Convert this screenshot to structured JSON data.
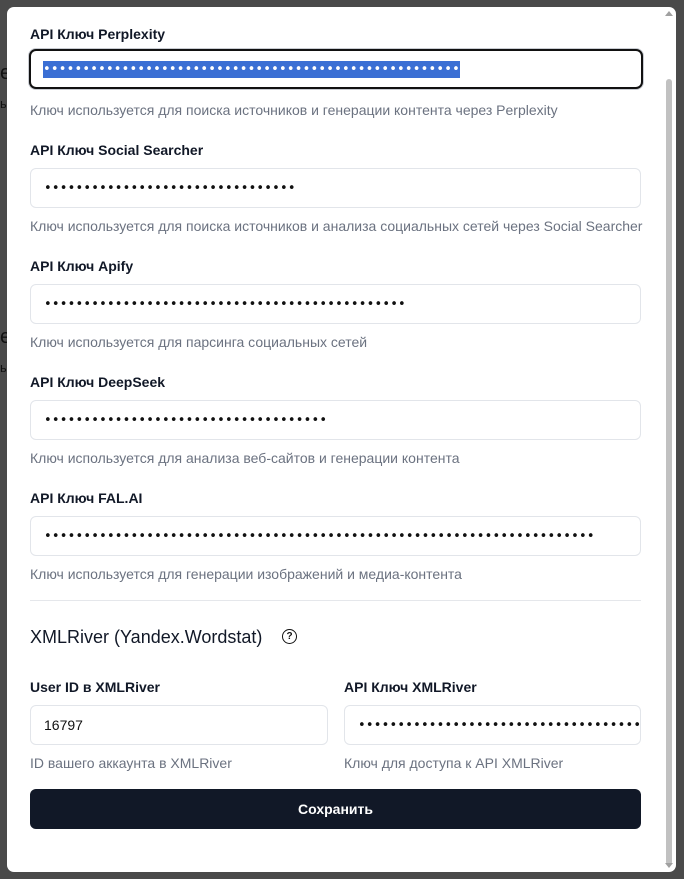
{
  "fields": [
    {
      "label": "API Ключ Perplexity",
      "value": "•••••••••••••••••••••••••••••••••••••••••••••••••••••",
      "hint": "Ключ используется для поиска источников и генерации контента через Perplexity"
    },
    {
      "label": "API Ключ Social Searcher",
      "value": "••••••••••••••••••••••••••••••••",
      "hint": "Ключ используется для поиска источников и анализа социальных сетей через Social Searcher"
    },
    {
      "label": "API Ключ Apify",
      "value": "••••••••••••••••••••••••••••••••••••••••••••••",
      "hint": "Ключ используется для парсинга социальных сетей"
    },
    {
      "label": "API Ключ DeepSeek",
      "value": "••••••••••••••••••••••••••••••••••••",
      "hint": "Ключ используется для анализа веб-сайтов и генерации контента"
    },
    {
      "label": "API Ключ FAL.AI",
      "value": "••••••••••••••••••••••••••••••••••••••••••••••••••••••••••••••••••••••",
      "hint": "Ключ используется для генерации изображений и медиа-контента"
    }
  ],
  "xmlriver": {
    "title": "XMLRiver (Yandex.Wordstat)",
    "help_icon": "?",
    "user_id_label": "User ID в XMLRiver",
    "user_id_value": "16797",
    "user_id_hint": "ID вашего аккаунта в XMLRiver",
    "api_key_label": "API Ключ XMLRiver",
    "api_key_value": "••••••••••••••••••••••••••••••••••••••••••",
    "api_key_hint": "Ключ для доступа к API XMLRiver"
  },
  "save_label": "Сохранить",
  "background_fragments": [
    "е",
    "ы",
    "е",
    "ы"
  ]
}
